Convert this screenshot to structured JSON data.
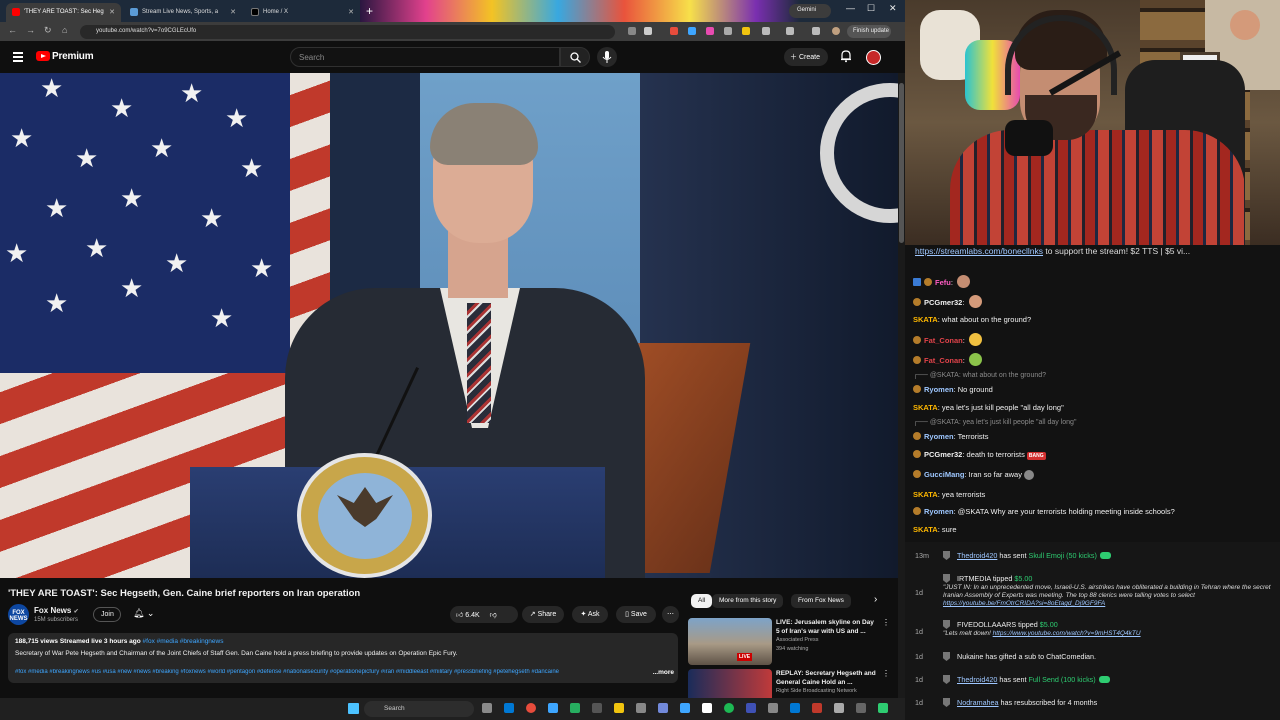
{
  "browser": {
    "tabs": [
      {
        "label": "'THEY ARE TOAST': Sec Heg",
        "color": "#ff0000"
      },
      {
        "label": "Stream Live News, Sports, a",
        "color": "#5b9bd5"
      },
      {
        "label": "Home / X",
        "color": "#000000"
      }
    ],
    "gemini": "Gemini",
    "url": "youtube.com/watch?v=7o9CGLEcUfo",
    "finish_update": "Finish update"
  },
  "youtube": {
    "brand": "Premium",
    "search_placeholder": "Search",
    "create": "Create"
  },
  "video": {
    "title": "'THEY ARE TOAST': Sec Hegseth, Gen. Caine brief reporters on Iran operation",
    "channel": "Fox News",
    "channel_avatar": "FOX NEWS",
    "subscribers": "15M subscribers",
    "join": "Join",
    "likes": "6.4K",
    "share": "Share",
    "ask": "Ask",
    "save": "Save"
  },
  "description": {
    "stats": "188,715 views  Streamed live 3 hours ago",
    "hashtags_top": "#fox #media #breakingnews",
    "text": "Secretary of War Pete Hegseth and Chairman of the Joint Chiefs of Staff Gen. Dan Caine hold a press briefing to provide updates on Operation Epic Fury.",
    "hashtags": "#fox #media #breakingnews #us #usa #new #news #breaking #foxnews #world #pentagon #defense #nationalsecurity #operationepicfury #iran #middleeast #military #pressbriefing #petehegseth #dancaine",
    "more": "...more"
  },
  "chips": [
    "All",
    "More from this story",
    "From Fox News"
  ],
  "recommendations": [
    {
      "title": "LIVE: Jerusalem skyline on Day 5 of Iran's war with US and ...",
      "channel": "Associated Press",
      "views": "394 watching",
      "live": "LIVE"
    },
    {
      "title": "REPLAY: Secretary Hegseth and General Caine Hold an ...",
      "channel": "Right Side Broadcasting Network",
      "views": ""
    }
  ],
  "taskbar": {
    "search": "Search"
  },
  "chat": {
    "banner_link": "https://streamlabs.com/bonecllnks",
    "banner_rest": " to support the stream! $2 TTS | $5 vi...",
    "messages": [
      {
        "name": "Fefu",
        "color": "#ff5cc3",
        "text": "",
        "reply": ""
      },
      {
        "name": "PCGmer32",
        "color": "#f0f0f0",
        "text": "",
        "reply": ""
      },
      {
        "name": "SKATA",
        "color": "#ffb800",
        "text": "what about on the ground?",
        "reply": ""
      },
      {
        "name": "Fat_Conan",
        "color": "#e0434a",
        "text": "",
        "reply": ""
      },
      {
        "name": "Fat_Conan",
        "color": "#e0434a",
        "text": "",
        "reply": ""
      },
      {
        "name": "",
        "color": "",
        "text": "",
        "reply": "@SKATA: what about on the ground?"
      },
      {
        "name": "Ryomen",
        "color": "#9ec7ff",
        "text": "No ground",
        "reply": ""
      },
      {
        "name": "SKATA",
        "color": "#ffb800",
        "text": "yea let's just kill people \"all day long\"",
        "reply": ""
      },
      {
        "name": "",
        "color": "",
        "text": "",
        "reply": "@SKATA: yea let's just kill people \"all day long\""
      },
      {
        "name": "Ryomen",
        "color": "#9ec7ff",
        "text": "Terrorists",
        "reply": ""
      },
      {
        "name": "PCGmer32",
        "color": "#f0f0f0",
        "text": "death to terrorists",
        "reply": "",
        "bang": "BANG"
      },
      {
        "name": "GucciMang",
        "color": "#9ec7ff",
        "text": "Iran so far away",
        "reply": ""
      },
      {
        "name": "SKATA",
        "color": "#ffb800",
        "text": "yea terrorists",
        "reply": ""
      },
      {
        "name": "Ryomen",
        "color": "#9ec7ff",
        "text": "@SKATA Why are your terrorists holding meeting inside schools?",
        "reply": ""
      },
      {
        "name": "SKATA",
        "color": "#ffb800",
        "text": "sure",
        "reply": ""
      }
    ]
  },
  "events": [
    {
      "time": "13m",
      "user": "Thedroid420",
      "text": " has sent ",
      "item": "Skull Emoji (50 kicks)"
    },
    {
      "time": "1d",
      "user": "IRTMEDIA",
      "text": " tipped ",
      "item": "$5.00",
      "quote": "\"JUST IN: In an unprecedented move, Israeli-U.S. airstrikes have obliterated a building in Tehran where the secret Iranian Assembly of Experts was meeting. The top 88 clerics were talling votes to select ",
      "link": "https://youtube.be/FmOtrCRIDA?si=8oEtagd_Dj9GF9FA"
    },
    {
      "time": "1d",
      "user": "FIVEDOLLAAARS",
      "text": " tipped ",
      "item": "$5.00",
      "quote": "\"Lets melt down! ",
      "link": "https://www.youtube.com/watch?v=9mHST4Q4kTU"
    },
    {
      "time": "1d",
      "user": "Nukaine",
      "text": " has gifted a sub to ",
      "item": "ChatComedian."
    },
    {
      "time": "1d",
      "user": "Thedroid420",
      "text": " has sent ",
      "item": "Full Send (100 kicks)"
    },
    {
      "time": "1d",
      "user": "Nodramahea",
      "text": " has resubscribed for 4 months",
      "item": ""
    }
  ]
}
